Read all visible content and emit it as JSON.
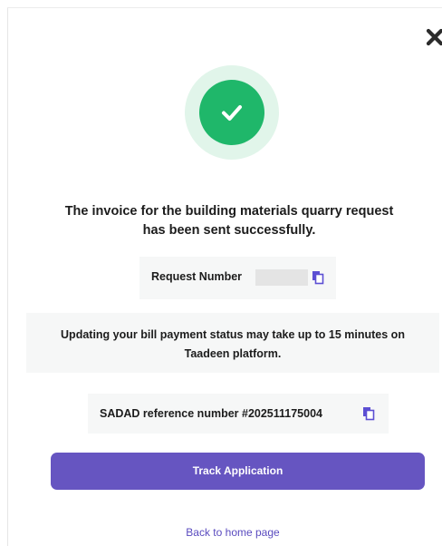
{
  "dialog": {
    "close_icon": "close-icon",
    "success_icon": "check-circle-icon",
    "headline_line1": "The invoice for the building materials quarry request",
    "headline_line2": "has been sent successfully.",
    "request_number_label": "Request Number",
    "request_number_value": "",
    "status_line1": "Updating your bill payment status may take up to 15 minutes on",
    "status_line2": "Taadeen platform.",
    "sadad_reference": "SADAD reference number #202511175004",
    "track_button_label": "Track Application",
    "back_link_label": "Back to home page",
    "copy_icon": "copy-icon"
  },
  "colors": {
    "success_green": "#1fb76a",
    "success_ring": "#e1f5ea",
    "primary_purple": "#6655c1",
    "link_purple": "#5a4bbf",
    "panel_grey": "#f6f7f7"
  }
}
